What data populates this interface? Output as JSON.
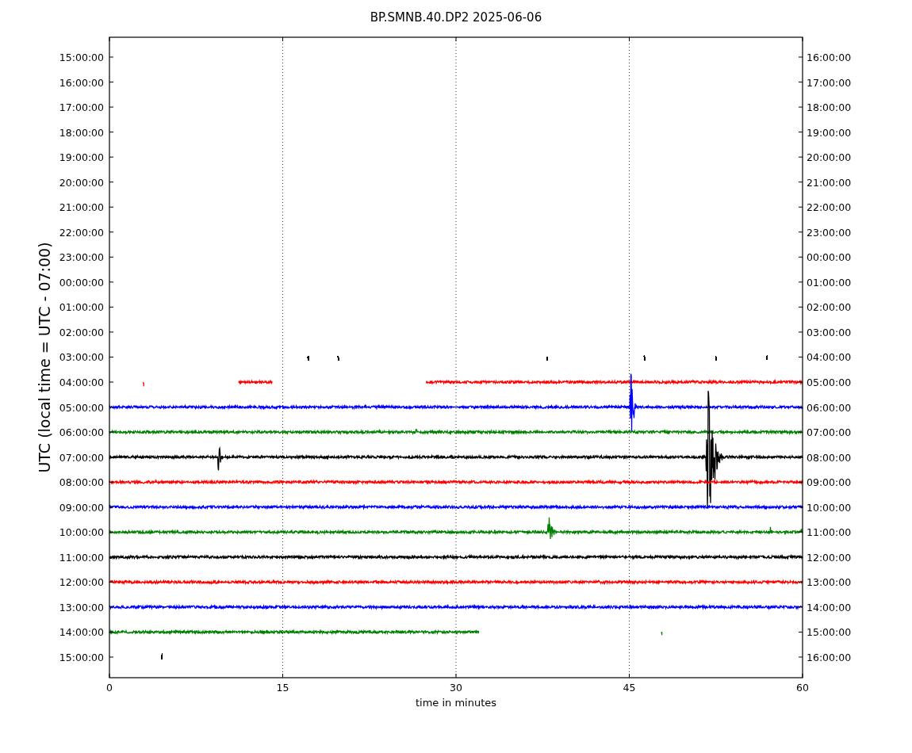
{
  "title": "BP.SMNB.40.DP2 2025-06-06",
  "ylabel": "UTC (local time = UTC - 07:00)",
  "xlabel": "time in minutes",
  "xticks": [
    "0",
    "15",
    "30",
    "45",
    "60"
  ],
  "rows": [
    {
      "left_label": "15:00:00",
      "right_label": "16:00:00"
    },
    {
      "left_label": "16:00:00",
      "right_label": "17:00:00"
    },
    {
      "left_label": "17:00:00",
      "right_label": "18:00:00"
    },
    {
      "left_label": "18:00:00",
      "right_label": "19:00:00"
    },
    {
      "left_label": "19:00:00",
      "right_label": "20:00:00"
    },
    {
      "left_label": "20:00:00",
      "right_label": "21:00:00"
    },
    {
      "left_label": "21:00:00",
      "right_label": "22:00:00"
    },
    {
      "left_label": "22:00:00",
      "right_label": "23:00:00"
    },
    {
      "left_label": "23:00:00",
      "right_label": "00:00:00"
    },
    {
      "left_label": "00:00:00",
      "right_label": "01:00:00"
    },
    {
      "left_label": "01:00:00",
      "right_label": "02:00:00"
    },
    {
      "left_label": "02:00:00",
      "right_label": "03:00:00"
    },
    {
      "left_label": "03:00:00",
      "right_label": "04:00:00",
      "color": "#000000"
    },
    {
      "left_label": "04:00:00",
      "right_label": "05:00:00",
      "color": "#ff0000"
    },
    {
      "left_label": "05:00:00",
      "right_label": "06:00:00",
      "color": "#0000ff"
    },
    {
      "left_label": "06:00:00",
      "right_label": "07:00:00",
      "color": "#008000"
    },
    {
      "left_label": "07:00:00",
      "right_label": "08:00:00",
      "color": "#000000"
    },
    {
      "left_label": "08:00:00",
      "right_label": "09:00:00",
      "color": "#ff0000"
    },
    {
      "left_label": "09:00:00",
      "right_label": "10:00:00",
      "color": "#0000ff"
    },
    {
      "left_label": "10:00:00",
      "right_label": "11:00:00",
      "color": "#008000"
    },
    {
      "left_label": "11:00:00",
      "right_label": "12:00:00",
      "color": "#000000"
    },
    {
      "left_label": "12:00:00",
      "right_label": "13:00:00",
      "color": "#ff0000"
    },
    {
      "left_label": "13:00:00",
      "right_label": "14:00:00",
      "color": "#0000ff"
    },
    {
      "left_label": "14:00:00",
      "right_label": "15:00:00",
      "color": "#008000"
    },
    {
      "left_label": "15:00:00",
      "right_label": "16:00:00",
      "color": "#000000"
    }
  ]
}
